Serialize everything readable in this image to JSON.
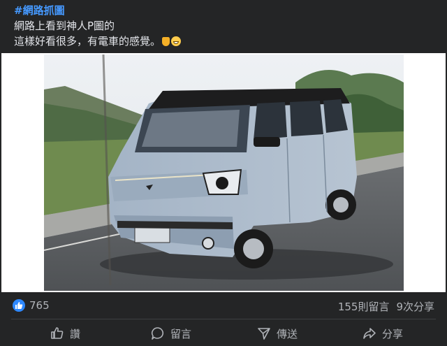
{
  "post": {
    "hashtag": "#網路抓圖",
    "line1": "網路上看到神人P圖的",
    "line2": "這樣好看很多，有電車的感覺。",
    "emoji_1": "thumbs-up-emoji",
    "emoji_2": "grinning-face-emoji"
  },
  "photo": {
    "subject": "van-photo",
    "accent_body": "#a9b8c8",
    "accent_roof": "#1c1c1c"
  },
  "stats": {
    "like_count": "765",
    "comments": "155則留言",
    "shares": "9次分享",
    "like_color": "#2d88ff"
  },
  "actions": {
    "like_label": "讚",
    "comment_label": "留言",
    "share_label": "傳送",
    "forward_label": "分享"
  }
}
